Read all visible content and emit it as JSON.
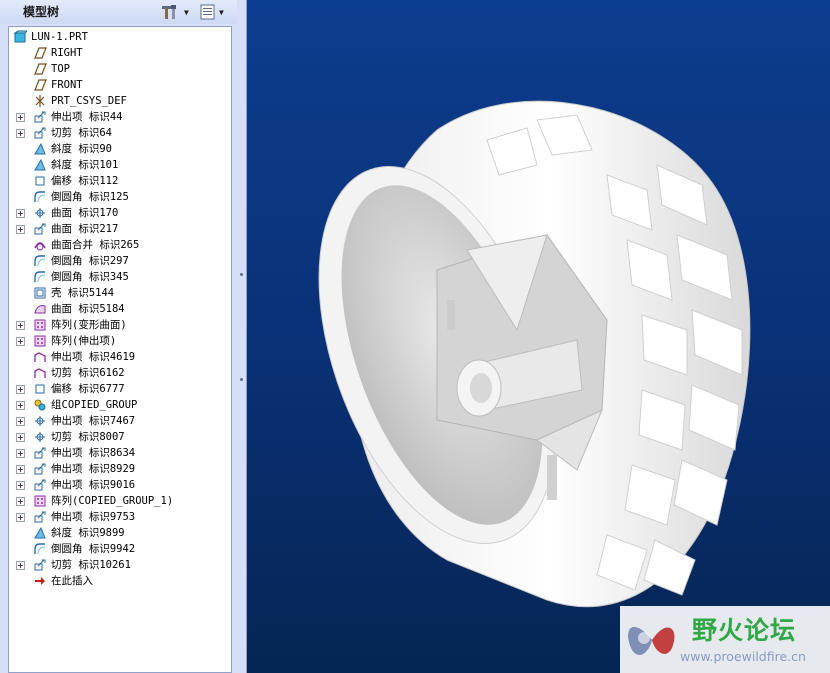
{
  "panel": {
    "title": "模型树"
  },
  "tree": {
    "root": "LUN-1.PRT",
    "items": [
      {
        "label": "RIGHT",
        "icon": "datum-plane-icon",
        "expandable": false
      },
      {
        "label": "TOP",
        "icon": "datum-plane-icon",
        "expandable": false
      },
      {
        "label": "FRONT",
        "icon": "datum-plane-icon",
        "expandable": false
      },
      {
        "label": "PRT_CSYS_DEF",
        "icon": "csys-icon",
        "expandable": false
      },
      {
        "label": "伸出项 标识44",
        "icon": "extrude-icon",
        "expandable": true
      },
      {
        "label": "切剪 标识64",
        "icon": "extrude-cut-icon",
        "expandable": true
      },
      {
        "label": "斜度 标识90",
        "icon": "draft-icon",
        "expandable": false
      },
      {
        "label": "斜度 标识101",
        "icon": "draft-icon",
        "expandable": false
      },
      {
        "label": "偏移 标识112",
        "icon": "offset-icon",
        "expandable": false
      },
      {
        "label": "倒圆角 标识125",
        "icon": "round-icon",
        "expandable": false
      },
      {
        "label": "曲面 标识170",
        "icon": "revolve-surface-icon",
        "expandable": true
      },
      {
        "label": "曲面 标识217",
        "icon": "extrude-icon",
        "expandable": true
      },
      {
        "label": "曲面合并 标识265",
        "icon": "merge-icon",
        "expandable": false
      },
      {
        "label": "倒圆角 标识297",
        "icon": "round-icon",
        "expandable": false
      },
      {
        "label": "倒圆角 标识345",
        "icon": "round-icon",
        "expandable": false
      },
      {
        "label": "壳 标识5144",
        "icon": "shell-icon",
        "expandable": false
      },
      {
        "label": "曲面 标识5184",
        "icon": "surface-icon",
        "expandable": false
      },
      {
        "label": "阵列(变形曲面)",
        "icon": "pattern-icon",
        "expandable": true
      },
      {
        "label": "阵列(伸出项)",
        "icon": "pattern-icon",
        "expandable": true
      },
      {
        "label": "伸出项 标识4619",
        "icon": "sweep-icon",
        "expandable": false
      },
      {
        "label": "切剪 标识6162",
        "icon": "sweep-icon",
        "expandable": false
      },
      {
        "label": "偏移 标识6777",
        "icon": "offset-icon",
        "expandable": true
      },
      {
        "label": "组COPIED_GROUP",
        "icon": "group-icon",
        "expandable": true
      },
      {
        "label": "伸出项 标识7467",
        "icon": "revolve-icon",
        "expandable": true
      },
      {
        "label": "切剪 标识8007",
        "icon": "revolve-icon",
        "expandable": true
      },
      {
        "label": "伸出项 标识8634",
        "icon": "extrude-icon",
        "expandable": true
      },
      {
        "label": "伸出项 标识8929",
        "icon": "extrude-icon",
        "expandable": true
      },
      {
        "label": "伸出项 标识9016",
        "icon": "extrude-icon",
        "expandable": true
      },
      {
        "label": "阵列(COPIED_GROUP_1)",
        "icon": "pattern-icon",
        "expandable": true
      },
      {
        "label": "伸出项 标识9753",
        "icon": "extrude-icon",
        "expandable": true
      },
      {
        "label": "斜度 标识9899",
        "icon": "draft-icon",
        "expandable": false
      },
      {
        "label": "倒圆角 标识9942",
        "icon": "round-icon",
        "expandable": false
      },
      {
        "label": "切剪 标识10261",
        "icon": "extrude-cut-icon",
        "expandable": true
      },
      {
        "label": "在此插入",
        "icon": "insert-here-arrow-icon",
        "expandable": false
      }
    ]
  },
  "viewport": {
    "model": "wheel-tire-3d-model"
  },
  "watermark": {
    "name": "野火论坛",
    "url": "www.proewildfire.cn"
  },
  "colors": {
    "viewport_top": "#0d3d8f",
    "viewport_bottom": "#052553",
    "logo_green": "#2fa845",
    "panel_bg": "#d6dff7"
  }
}
